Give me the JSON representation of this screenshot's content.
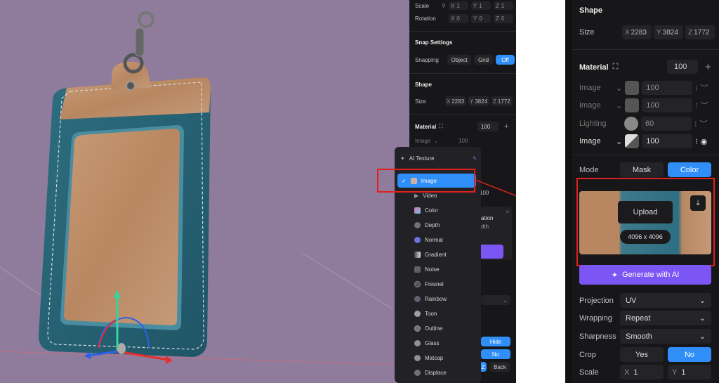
{
  "left_panel": {
    "scale_label": "Scale",
    "scale_x": "1",
    "scale_y": "1",
    "scale_z": "1",
    "rotation_label": "Rotation",
    "rot_x": "0",
    "rot_y": "0",
    "rot_z": "0",
    "snap_title": "Snap Settings",
    "snapping_label": "Snapping",
    "snap_object": "Object",
    "snap_grid": "Grid",
    "snap_off": "Off",
    "shape_title": "Shape",
    "size_label": "Size",
    "size_x": "2283",
    "size_y": "3824",
    "size_z": "1772",
    "material_title": "Material",
    "material_value": "100",
    "layer_label": "Image",
    "layer_val": "100",
    "under_val": "100",
    "popup_line1": "ation",
    "popup_line2": "dth",
    "hide_label": "Hide",
    "no_label": "No",
    "z_label": "Z",
    "back_label": "Back"
  },
  "dropdown": {
    "items": [
      {
        "label": "AI Texture",
        "icon": "sparkle-icon",
        "color": "#8a8a90"
      },
      {
        "label": "Image",
        "icon": "image-icon",
        "color": "#d0b0a0"
      },
      {
        "label": "Video",
        "icon": "play-icon",
        "color": "#8a8a90"
      },
      {
        "label": "Color",
        "icon": "color-icon",
        "color": "#e070c0"
      },
      {
        "label": "Depth",
        "icon": "depth-icon",
        "color": "#707075"
      },
      {
        "label": "Normal",
        "icon": "normal-icon",
        "color": "#7070e0"
      },
      {
        "label": "Gradient",
        "icon": "gradient-icon",
        "color": "#c0c0c0"
      },
      {
        "label": "Noise",
        "icon": "noise-icon",
        "color": "#606065"
      },
      {
        "label": "Fresnel",
        "icon": "fresnel-icon",
        "color": "#505055"
      },
      {
        "label": "Rainbow",
        "icon": "rainbow-icon",
        "color": "#606070"
      },
      {
        "label": "Toon",
        "icon": "toon-icon",
        "color": "#a0a0a0"
      },
      {
        "label": "Outline",
        "icon": "outline-icon",
        "color": "#707075"
      },
      {
        "label": "Glass",
        "icon": "glass-icon",
        "color": "#909095"
      },
      {
        "label": "Matcap",
        "icon": "matcap-icon",
        "color": "#909095"
      },
      {
        "label": "Displace",
        "icon": "displace-icon",
        "color": "#707075"
      }
    ]
  },
  "right_panel": {
    "shape_title": "Shape",
    "size_label": "Size",
    "size_x": "2283",
    "size_y": "3824",
    "size_z": "1772",
    "material_title": "Material",
    "material_value": "100",
    "layers": [
      {
        "label": "Image",
        "value": "100"
      },
      {
        "label": "Image",
        "value": "100"
      },
      {
        "label": "Lighting",
        "value": "60"
      },
      {
        "label": "Image",
        "value": "100"
      }
    ],
    "mode_label": "Mode",
    "mode_mask": "Mask",
    "mode_color": "Color",
    "upload_label": "Upload",
    "dims_label": "4096 x 4096",
    "generate_label": "Generate with AI",
    "projection_label": "Projection",
    "projection_value": "UV",
    "wrapping_label": "Wrapping",
    "wrapping_value": "Repeat",
    "sharpness_label": "Sharpness",
    "sharpness_value": "Smooth",
    "crop_label": "Crop",
    "crop_yes": "Yes",
    "crop_no": "No",
    "scale_label": "Scale",
    "scale_x": "1",
    "scale_y": "1"
  },
  "colors": {
    "accent": "#2f8ef8",
    "purple": "#7b56f5",
    "annotation_red": "#e0201c"
  }
}
